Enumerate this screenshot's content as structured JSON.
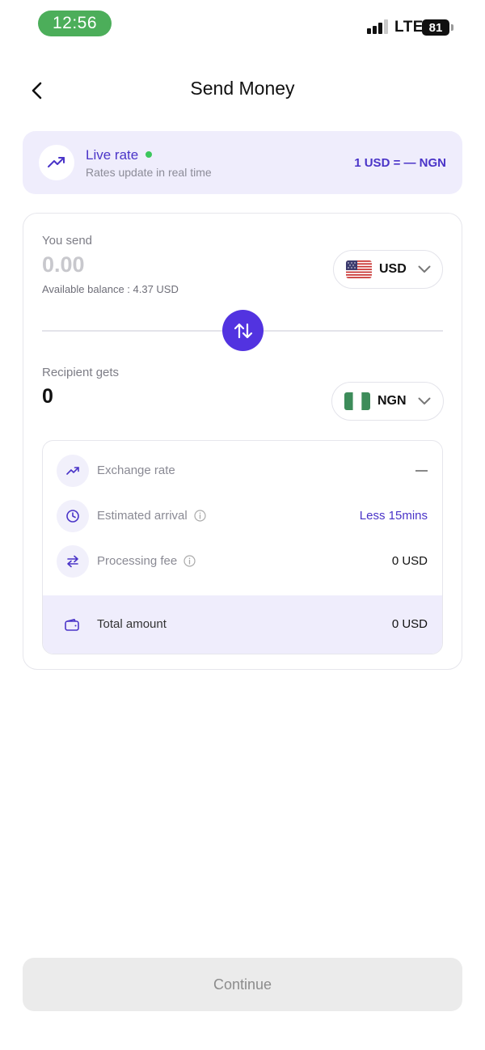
{
  "status_bar": {
    "time": "12:56",
    "network": "LTE",
    "battery": "81"
  },
  "header": {
    "title": "Send Money"
  },
  "rate_banner": {
    "title": "Live rate",
    "subtitle": "Rates update in real time",
    "rate": "1 USD = — NGN"
  },
  "send": {
    "label": "You send",
    "amount": "0.00",
    "balance": "Available balance : 4.37 USD",
    "currency": "USD"
  },
  "receive": {
    "label": "Recipient gets",
    "amount": "0",
    "currency": "NGN"
  },
  "details": {
    "exchange_rate_label": "Exchange rate",
    "exchange_rate_value": "—",
    "arrival_label": "Estimated arrival",
    "arrival_value": "Less 15mins",
    "fee_label": "Processing fee",
    "fee_value": "0 USD",
    "total_label": "Total amount",
    "total_value": "0 USD"
  },
  "footer": {
    "continue_label": "Continue"
  },
  "colors": {
    "accent": "#5233e0",
    "accent_text": "#4a34c8",
    "banner_bg": "#efedfc",
    "live_dot": "#3cc65c",
    "status_pill": "#4cae5a",
    "disabled_button": "#ebebeb"
  },
  "icons": {
    "back": "chevron-left-icon",
    "trend": "trending-up-icon",
    "swap": "swap-vertical-icon",
    "clock": "clock-icon",
    "transfer": "arrows-left-right-icon",
    "info": "info-icon",
    "wallet": "wallet-icon"
  }
}
